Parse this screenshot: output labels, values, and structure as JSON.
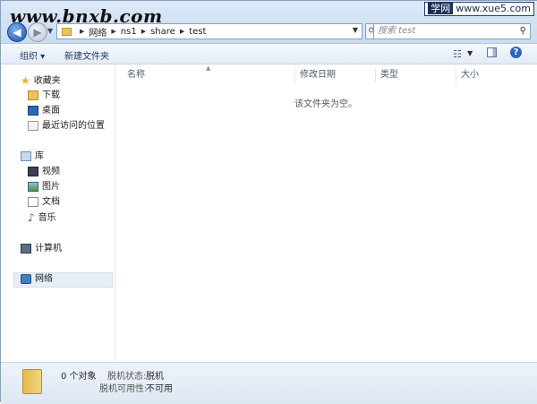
{
  "watermarks": {
    "left": "www.bnxb.com",
    "right_badge": "学网",
    "right_url": "www.xue5.com"
  },
  "address": {
    "crumbs": [
      "网络",
      "ns1",
      "share",
      "test"
    ]
  },
  "search": {
    "placeholder": "搜索 test"
  },
  "toolbar": {
    "organize_label": "组织 ▾",
    "new_folder_label": "新建文件夹"
  },
  "sidebar": {
    "favorites": {
      "label": "收藏夹",
      "items": [
        {
          "label": "下载",
          "icon": "download-folder-icon"
        },
        {
          "label": "桌面",
          "icon": "desktop-icon"
        },
        {
          "label": "最近访问的位置",
          "icon": "recent-places-icon"
        }
      ]
    },
    "libraries": {
      "label": "库",
      "items": [
        {
          "label": "视频",
          "icon": "video-icon"
        },
        {
          "label": "图片",
          "icon": "pictures-icon"
        },
        {
          "label": "文档",
          "icon": "documents-icon"
        },
        {
          "label": "音乐",
          "icon": "music-icon"
        }
      ]
    },
    "computer": {
      "label": "计算机"
    },
    "network": {
      "label": "网络"
    }
  },
  "columns": [
    "名称",
    "修改日期",
    "类型",
    "大小"
  ],
  "empty_message": "该文件夹为空。",
  "details": {
    "count": "0 个对象",
    "offline_state_label": "脱机状态:",
    "offline_state_value": "脱机",
    "offline_avail_label": "脱机可用性:",
    "offline_avail_value": "不可用"
  }
}
